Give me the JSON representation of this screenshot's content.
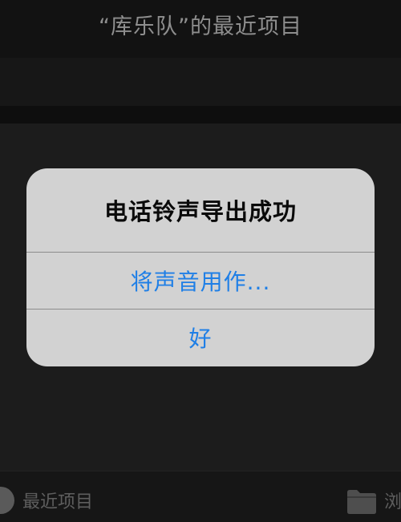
{
  "nav": {
    "title": "“库乐队”的最近项目"
  },
  "alert": {
    "title": "电话铃声导出成功",
    "buttons": [
      {
        "label": "将声音用作..."
      },
      {
        "label": "好"
      }
    ]
  },
  "tabbar": {
    "recent": {
      "label": "最近项目",
      "icon": "clock-icon"
    },
    "browse": {
      "label": "浏览",
      "icon": "folder-icon"
    }
  },
  "colors": {
    "accent": "#1f7fe6",
    "alert_bg": "#d2d2d2",
    "background": "#1c1c1c"
  }
}
